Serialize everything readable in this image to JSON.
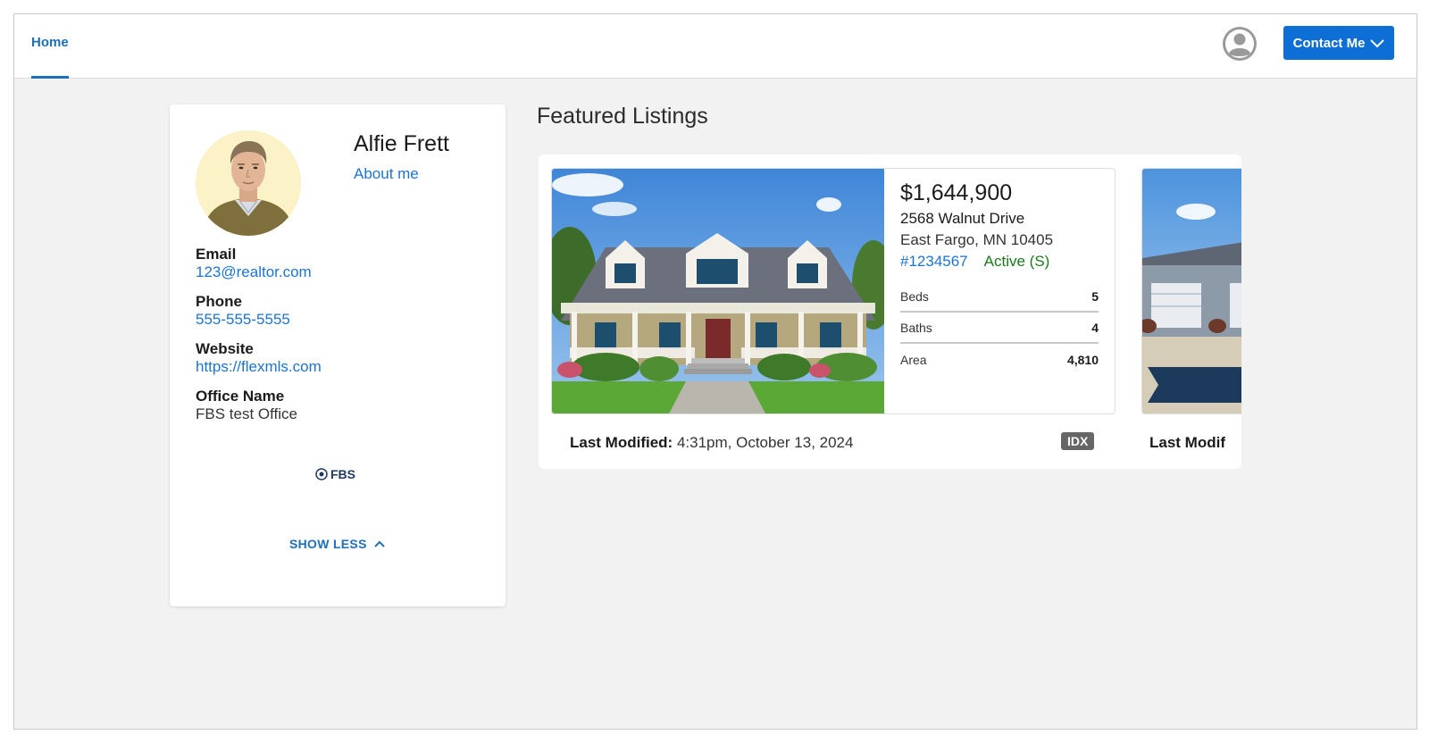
{
  "nav": {
    "home_label": "Home",
    "contact_label": "Contact Me",
    "accent": "#0d6fd6"
  },
  "profile": {
    "name": "Alfie Frett",
    "about_label": "About me",
    "email_label": "Email",
    "email_value": "123@realtor.com",
    "phone_label": "Phone",
    "phone_value": "555-555-5555",
    "website_label": "Website",
    "website_value": "https://flexmls.com",
    "office_label": "Office Name",
    "office_value": "FBS test Office",
    "logo_text": "FBS",
    "show_less_label": "SHOW LESS"
  },
  "featured": {
    "title": "Featured Listings",
    "listings": [
      {
        "price": "$1,644,900",
        "street": "2568 Walnut Drive",
        "city": "East Fargo, MN 10405",
        "mls_number": "#1234567",
        "status": "Active (S)",
        "specs": [
          {
            "label": "Beds",
            "value": "5"
          },
          {
            "label": "Baths",
            "value": "4"
          },
          {
            "label": "Area",
            "value": "4,810"
          }
        ],
        "last_modified_label": "Last Modified:",
        "last_modified_value": "4:31pm, October 13, 2024",
        "badge": "IDX"
      },
      {
        "last_modified_label": "Last Modif"
      }
    ]
  }
}
